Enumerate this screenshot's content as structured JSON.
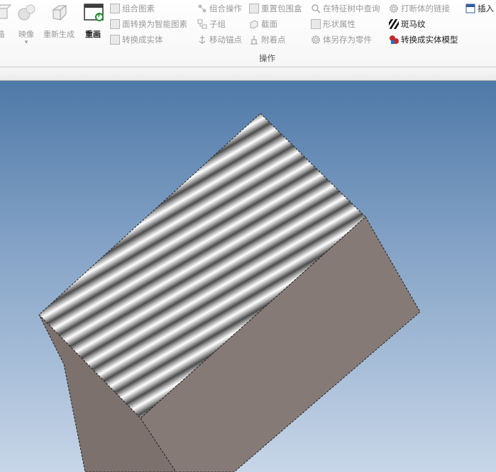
{
  "ribbon": {
    "cut_left_label": "箱",
    "mirror_label": "映像",
    "regenerate_label": "重新生成",
    "redraw_label": "重画",
    "col1": {
      "combine_shapes": "组合图素",
      "face_to_smart": "面转换为智能图素",
      "convert_to_solid": "转换成实体"
    },
    "col2": {
      "combine_op": "组合操作",
      "subgroup": "子组",
      "move_anchor": "移动锚点"
    },
    "col3": {
      "reset_bbox": "重置包围盒",
      "section": "截面",
      "attach_point": "附着点"
    },
    "col4": {
      "query_in_tree": "在特征树中查询",
      "shape_props": "形状属性",
      "save_as_part": "体另存为零件"
    },
    "col5": {
      "break_link": "打断体的链接",
      "zebra": "斑马纹",
      "convert_to_solid_model": "转换成实体模型"
    },
    "insert_label": "插入",
    "group_label": "操作"
  },
  "colors": {
    "viewport_top": "#4f79a8",
    "viewport_bottom": "#c7d6e8",
    "cube_side": "#857a76",
    "zebra_dark": "#555555",
    "zebra_light": "#ffffff"
  }
}
